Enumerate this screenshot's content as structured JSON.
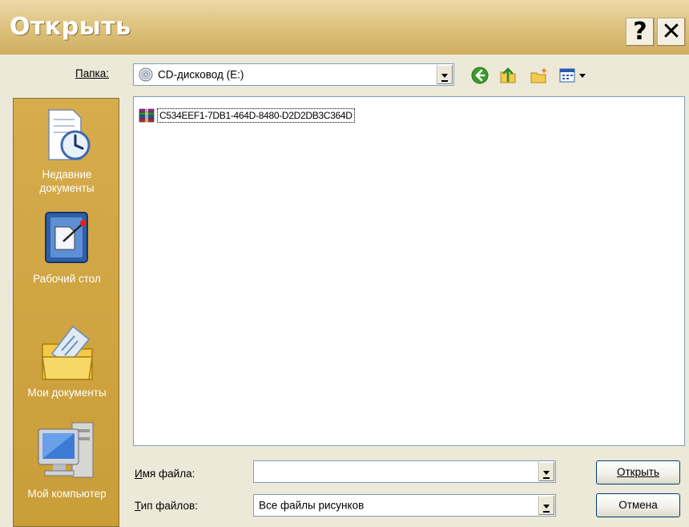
{
  "dialog": {
    "title": "Открыть",
    "help_label": "?",
    "close_label": "✕"
  },
  "folder": {
    "label": "Папка:",
    "value": "CD-дисковод (E:)"
  },
  "toolbar": {
    "back_icon": "back-arrow-icon",
    "up_icon": "folder-up-icon",
    "new_folder_icon": "new-folder-icon",
    "view_menu_icon": "view-menu-icon"
  },
  "places": [
    {
      "label": "Недавние документы",
      "icon": "recent-documents-icon"
    },
    {
      "label": "Рабочий стол",
      "icon": "desktop-icon"
    },
    {
      "label": "Мои документы",
      "icon": "my-documents-icon"
    },
    {
      "label": "Мой компьютер",
      "icon": "my-computer-icon"
    }
  ],
  "files": [
    {
      "name": "C534EEF1-7DB1-464D-8480-D2D2DB3C364D",
      "icon": "archive-icon"
    }
  ],
  "filename": {
    "label": "Имя файла:",
    "value": ""
  },
  "filetype": {
    "label": "Тип файлов:",
    "value": "Все файлы рисунков"
  },
  "buttons": {
    "open": "Открыть",
    "cancel": "Отмена"
  },
  "colors": {
    "title_bar": "#dcc07a",
    "places_bar": "#d6ac4c",
    "accent_border": "#7f9db9"
  }
}
